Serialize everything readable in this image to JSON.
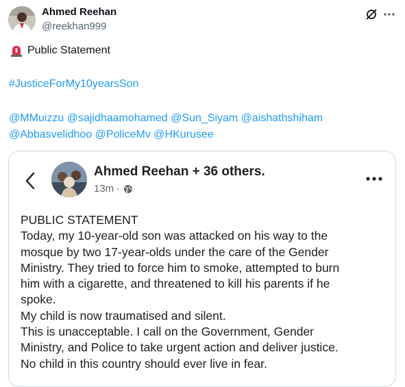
{
  "tweet": {
    "author_name": "Ahmed Reehan",
    "author_handle": "@reekhan999",
    "icons": {
      "grok": "grok-icon",
      "more": "more-horizontal-icon",
      "siren": "police-siren-emoji"
    },
    "line1": "Public Statement",
    "hashtag": "#JusticeForMy10yearsSon",
    "mentions": [
      "@MMuizzu",
      "@sajidhaamohamed",
      "@Sun_Siyam",
      "@aishathshiham",
      "@Abbasvelidhoo",
      "@PoliceMv",
      "@HKurusee"
    ]
  },
  "card": {
    "author": "Ahmed Reehan + 36 others.",
    "time": "13m",
    "separator": "·",
    "icons": {
      "back": "chevron-left-icon",
      "privacy": "globe-icon",
      "more": "more-horizontal-icon"
    },
    "statement_lines": [
      "PUBLIC STATEMENT",
      "Today, my 10-year-old son was attacked on his way to the",
      "mosque by two 17-year-olds under the care of the Gender",
      "Ministry. They tried to force him to smoke, attempted to burn",
      "him with a cigarette, and threatened to kill his parents if he",
      "spoke.",
      "My child is now traumatised and silent.",
      "This is unacceptable. I call on the Government, Gender",
      "Ministry, and Police to take urgent action and deliver justice.",
      "No child in this country should ever live in fear."
    ]
  },
  "colors": {
    "link": "#1d9bf0",
    "text": "#0f1419",
    "muted": "#536471",
    "border": "#cfd9de"
  }
}
